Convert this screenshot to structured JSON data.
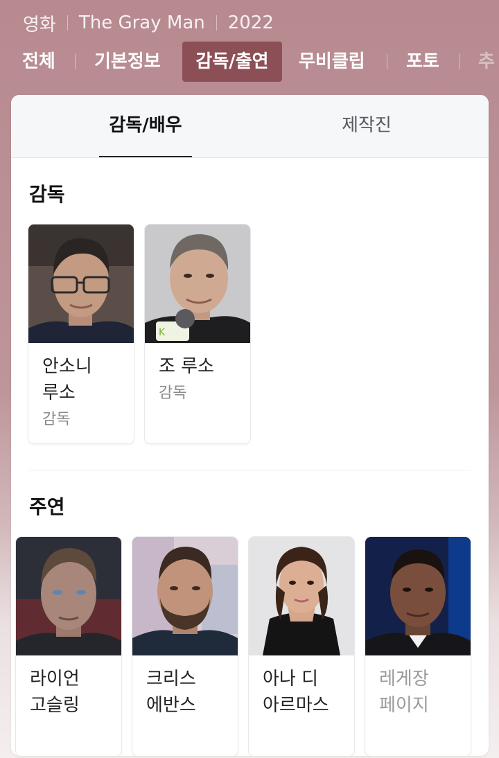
{
  "breadcrumb": {
    "category": "영화",
    "title": "The Gray Man",
    "year": "2022"
  },
  "top_nav": {
    "tabs": [
      {
        "label": "전체"
      },
      {
        "label": "기본정보"
      },
      {
        "label": "감독/출연"
      },
      {
        "label": "무비클립"
      },
      {
        "label": "포토"
      },
      {
        "label": "추"
      }
    ],
    "active_index": 2
  },
  "subtabs": {
    "items": [
      {
        "label": "감독/배우"
      },
      {
        "label": "제작진"
      }
    ],
    "active_index": 0
  },
  "sections": {
    "directors": {
      "title": "감독",
      "people": [
        {
          "name": "안소니 루소",
          "role": "감독"
        },
        {
          "name": "조 루소",
          "role": "감독"
        }
      ]
    },
    "cast": {
      "title": "주연",
      "people": [
        {
          "name": "라이언 고슬링"
        },
        {
          "name": "크리스 에반스"
        },
        {
          "name": "아나 디 아르마스"
        },
        {
          "name": "레게장 페이지"
        }
      ]
    }
  },
  "colors": {
    "header_bg": "#b78a90",
    "active_tab_bg": "#8c4f55",
    "card_bg": "#ffffff",
    "subtab_bg": "#f6f7f9"
  }
}
